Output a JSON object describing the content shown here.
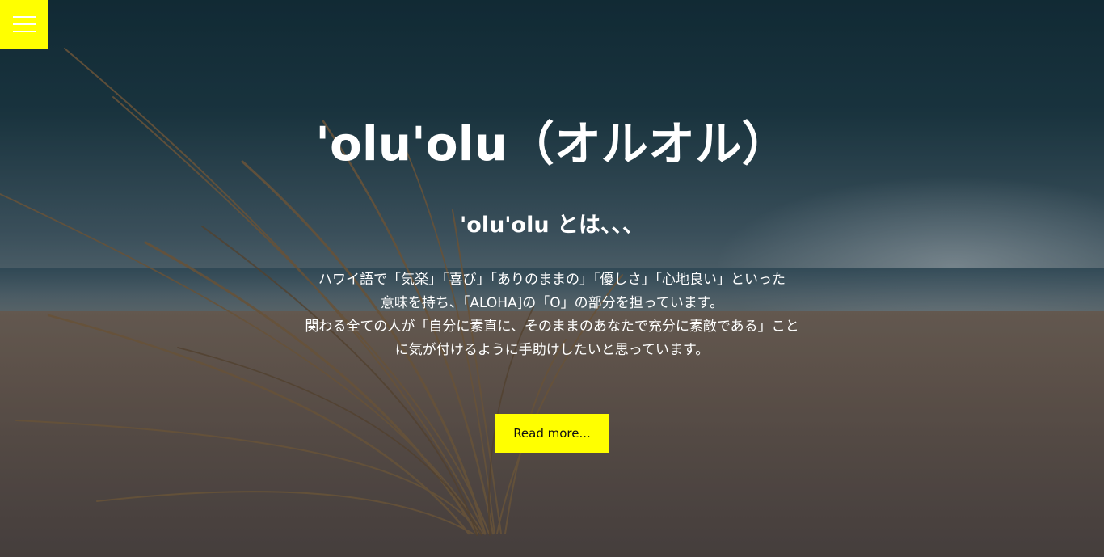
{
  "menu": {
    "icon": "hamburger-menu-icon",
    "color": "#ffff00"
  },
  "hero": {
    "title": "'olu'olu（オルオル）",
    "subtitle": "'olu'olu とは、、、",
    "description": [
      "ハワイ語で「気楽」「喜び」「ありのままの」「優しさ」「心地良い」といった",
      "意味を持ち、「ALOHA]の「O」の部分を担っています。",
      "関わる全ての人が「自分に素直に、そのままのあなたで充分に素敵である」こと",
      "に気が付けるように手助けしたいと思っています。"
    ],
    "cta_label": "Read more...",
    "accent_color": "#ffff00"
  }
}
